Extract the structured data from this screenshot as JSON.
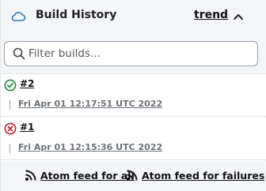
{
  "header": {
    "title": "Build History",
    "trend_label": "trend",
    "icon": "cloud-icon",
    "collapse_icon": "chevron-up-icon"
  },
  "filter": {
    "placeholder": "Filter builds...",
    "value": ""
  },
  "builds": [
    {
      "number": "#2",
      "status": "success",
      "status_icon": "check-circle-icon",
      "timestamp": "Fri Apr 01 12:17:51 UTC 2022",
      "status_color": "#1e8a3a"
    },
    {
      "number": "#1",
      "status": "failure",
      "status_icon": "x-circle-icon",
      "timestamp": "Fri Apr 01 12:15:36 UTC 2022",
      "status_color": "#c21f2c"
    }
  ],
  "footer": {
    "feed_all": "Atom feed for all",
    "feed_failures": "Atom feed for failures",
    "icon": "rss-icon"
  },
  "colors": {
    "header_bg": "#f3f5f8",
    "accent": "#2a7bb6"
  }
}
